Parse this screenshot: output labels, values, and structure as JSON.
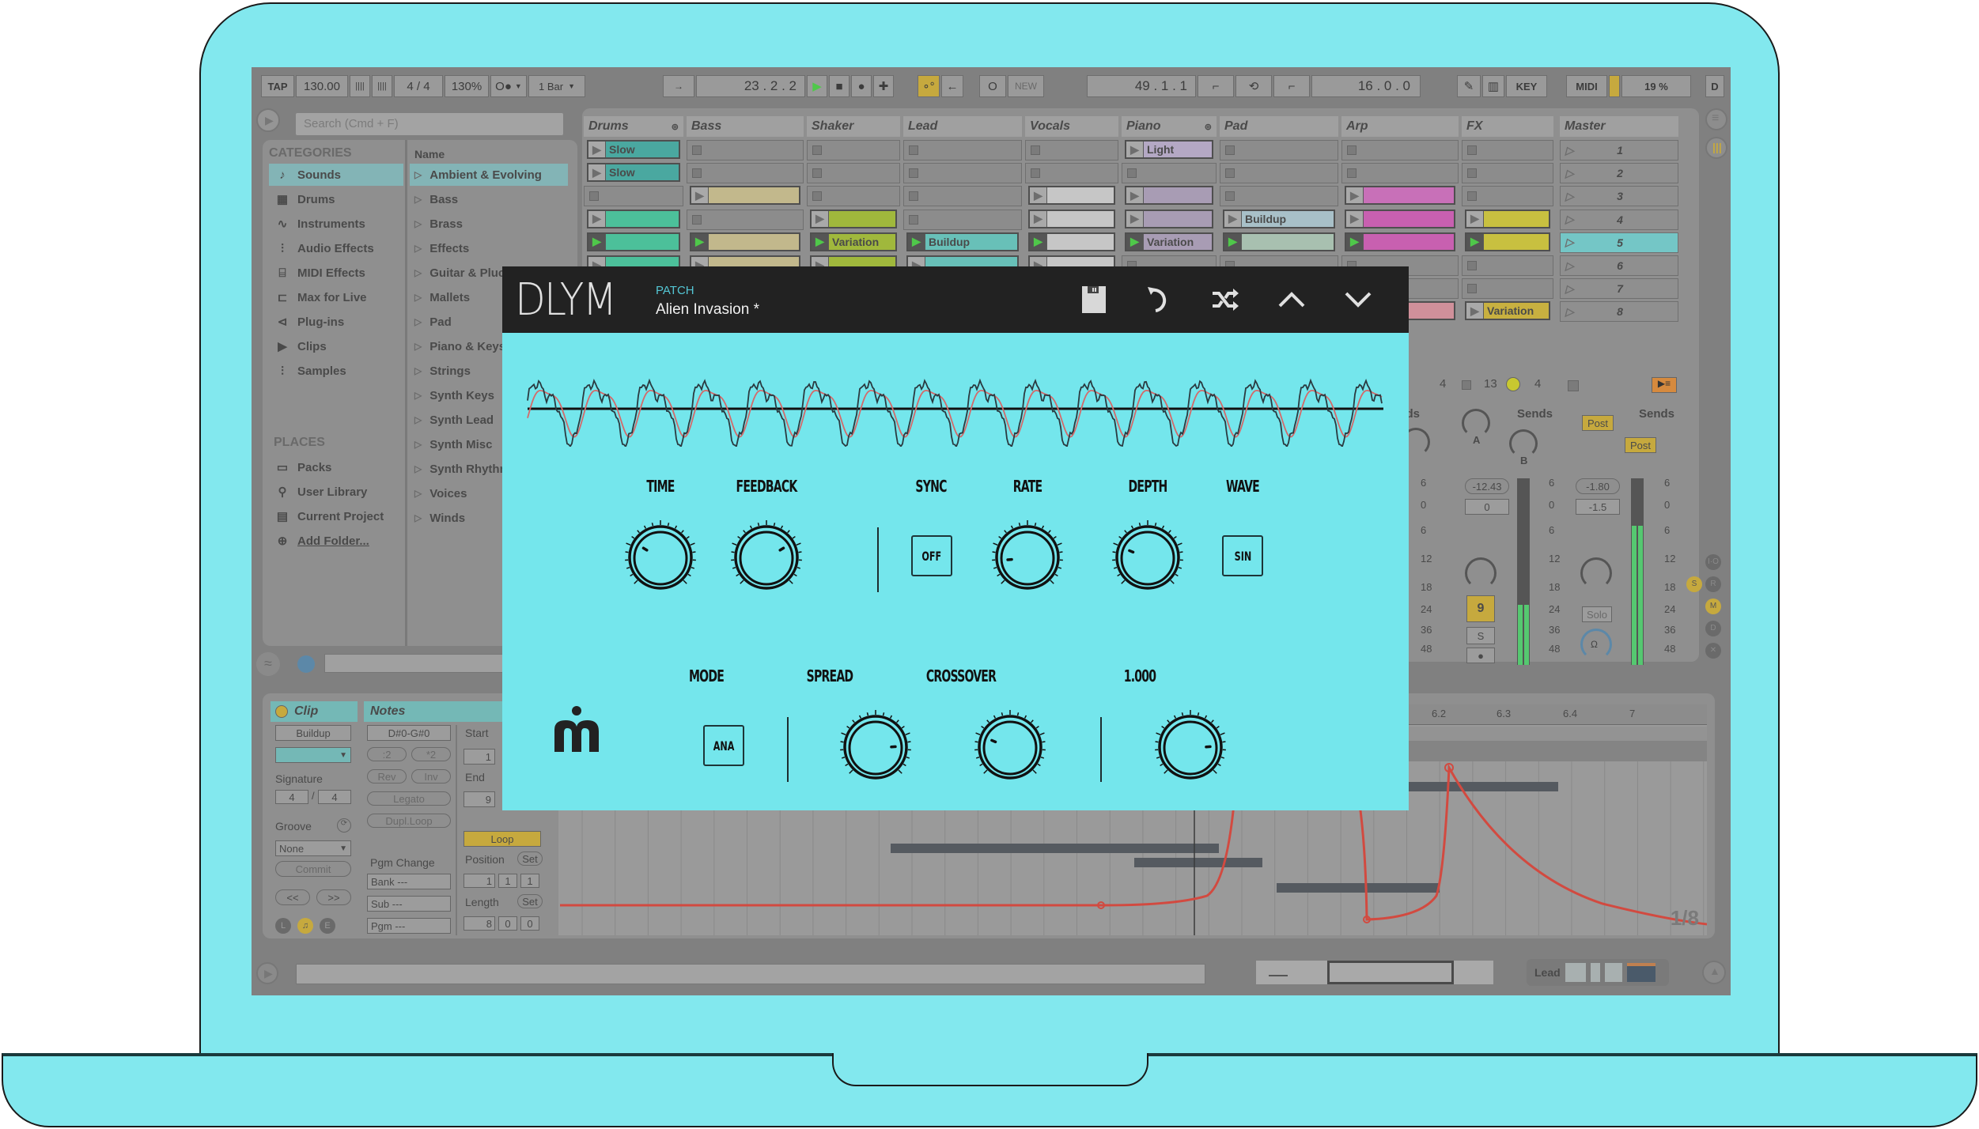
{
  "colors": {
    "background_accent": "#82e8ee",
    "plugin_bg": "#74e6ec",
    "plugin_header": "#222222",
    "patch_label": "#54c6d4",
    "daw_overlay": "#808080",
    "play_green": "#4fc84a",
    "envelope_red": "#d24a40"
  },
  "transport": {
    "tap": "TAP",
    "tempo": "130.00",
    "nudge_down": "||||",
    "nudge_up": "||||",
    "time_signature": "4 / 4",
    "zoom": "130%",
    "metronome": "O●",
    "quantize": "1 Bar",
    "follow": "→",
    "position": "23 . 2 . 2",
    "play": "▶",
    "stop": "■",
    "record": "●",
    "add": "✚",
    "automation_arm": "∘°",
    "back_to_arrangement": "←",
    "session_record": "O",
    "new": "NEW",
    "loop_start": "49 . 1 . 1",
    "loop_length": "16 . 0 . 0",
    "key": "KEY",
    "midi": "MIDI",
    "cpu": "19 %",
    "disk": "D"
  },
  "browser": {
    "search_placeholder": "Search (Cmd + F)",
    "categories_header": "CATEGORIES",
    "name_header": "Name",
    "categories": [
      {
        "label": "Sounds",
        "icon": "♪",
        "selected": true
      },
      {
        "label": "Drums",
        "icon": "▦"
      },
      {
        "label": "Instruments",
        "icon": "∿"
      },
      {
        "label": "Audio Effects",
        "icon": "⫶"
      },
      {
        "label": "MIDI Effects",
        "icon": "⌸"
      },
      {
        "label": "Max for Live",
        "icon": "⊏"
      },
      {
        "label": "Plug-ins",
        "icon": "⊲"
      },
      {
        "label": "Clips",
        "icon": "▶"
      },
      {
        "label": "Samples",
        "icon": "⫶"
      }
    ],
    "places_header": "PLACES",
    "places": [
      {
        "label": "Packs",
        "icon": "▭"
      },
      {
        "label": "User Library",
        "icon": "⚲"
      },
      {
        "label": "Current Project",
        "icon": "▤"
      },
      {
        "label": "Add Folder...",
        "icon": "⊕"
      }
    ],
    "names": [
      "Ambient & Evolving",
      "Bass",
      "Brass",
      "Effects",
      "Guitar & Pluc",
      "Mallets",
      "Pad",
      "Piano & Keys",
      "Strings",
      "Synth Keys",
      "Synth Lead",
      "Synth Misc",
      "Synth Rhythm",
      "Voices",
      "Winds"
    ]
  },
  "session": {
    "tracks": [
      "Drums",
      "Bass",
      "Shaker",
      "Lead",
      "Vocals",
      "Piano",
      "Pad",
      "Arp",
      "FX"
    ],
    "master": "Master",
    "scenes": [
      "1",
      "2",
      "3",
      "4",
      "5",
      "6",
      "7",
      "8"
    ],
    "clips": {
      "drums_1": "Slow",
      "drums_2": "Slow",
      "piano_1": "Light",
      "pad_4": "Buildup",
      "shaker_5": "Variation",
      "lead_5": "Buildup",
      "piano_5": "Variation",
      "fx_8": "Variation"
    }
  },
  "mixer": {
    "track_num": "13",
    "track_num_prev": "4",
    "sends_label": "Sends",
    "send_a": "A",
    "send_b": "B",
    "post_1": "Post",
    "post_2": "Post",
    "fx_volume": "-12.43",
    "fx_pan": "0",
    "master_volume": "-1.80",
    "master_pan": "-1.5",
    "scale": [
      "6",
      "0",
      "6",
      "12",
      "18",
      "24",
      "36",
      "48"
    ],
    "activator": "9",
    "solo_s": "S",
    "solo": "Solo",
    "side_buttons": [
      "I·O",
      "S",
      "R",
      "M",
      "D",
      "✕"
    ]
  },
  "clip_view": {
    "clip_title": "Clip",
    "clip_name": "Buildup",
    "signature_label": "Signature",
    "sig_num": "4",
    "sig_den": "4",
    "groove_label": "Groove",
    "groove_value": "None",
    "commit": "Commit",
    "prev": "<<",
    "next": ">>",
    "notes_title": "Notes",
    "note_range": "D#0-G#0",
    "half": ":2",
    "double": "*2",
    "rev": "Rev",
    "inv": "Inv",
    "legato": "Legato",
    "dupl_loop": "Dupl.Loop",
    "pgm_change": "Pgm Change",
    "bank": "Bank ---",
    "sub": "Sub ---",
    "pgm": "Pgm ---",
    "start_label": "Start",
    "start_value": "1",
    "end_label": "End",
    "end_value": "9",
    "loop": "Loop",
    "position_label": "Position",
    "set": "Set",
    "position_values": [
      "1",
      "1",
      "1"
    ],
    "length_label": "Length",
    "length_values": [
      "8",
      "0",
      "0"
    ],
    "ruler": [
      "6.2",
      "6.3",
      "6.4",
      "7"
    ],
    "grid": "1/8",
    "mode_buttons": [
      "L",
      "♫",
      "E"
    ]
  },
  "status_bar": {
    "track_name": "Lead"
  },
  "plugin": {
    "name": "DLYM",
    "patch_label": "PATCH",
    "patch_name": "Alien Invasion *",
    "icons": [
      "save-icon",
      "undo-icon",
      "randomize-icon",
      "previous-patch-icon",
      "next-patch-icon"
    ],
    "row1": {
      "time": {
        "label": "TIME",
        "value": 0.28
      },
      "feedback": {
        "label": "FEEDBACK",
        "value": 0.72
      },
      "sync": {
        "label": "SYNC",
        "value": "OFF"
      },
      "rate": {
        "label": "RATE",
        "value": 0.15
      },
      "depth": {
        "label": "DEPTH",
        "value": 0.25
      },
      "wave": {
        "label": "WAVE",
        "value": "SIN"
      }
    },
    "row2": {
      "mode": {
        "label": "MODE",
        "value": "ANA"
      },
      "spread": {
        "label": "SPREAD",
        "value": 0.82
      },
      "crossover": {
        "label": "CROSSOVER",
        "value": 0.25
      },
      "mix": {
        "label": "1.000",
        "value": 0.82
      }
    },
    "brand_logo": "m"
  }
}
